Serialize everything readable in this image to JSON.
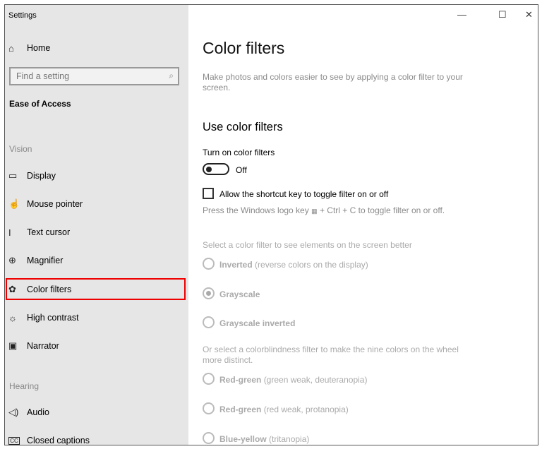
{
  "window": {
    "title": "Settings",
    "minimize": "—",
    "maximize": "☐",
    "close": "✕"
  },
  "sidebar": {
    "home": "Home",
    "search_placeholder": "Find a setting",
    "section": "Ease of Access",
    "groups": [
      {
        "label": "Vision"
      },
      {
        "label": "Hearing"
      }
    ],
    "items": [
      {
        "label": "Display",
        "icon": "display-icon"
      },
      {
        "label": "Mouse pointer",
        "icon": "mouse-pointer-icon"
      },
      {
        "label": "Text cursor",
        "icon": "text-cursor-icon"
      },
      {
        "label": "Magnifier",
        "icon": "magnifier-icon"
      },
      {
        "label": "Color filters",
        "icon": "palette-icon",
        "selected": true
      },
      {
        "label": "High contrast",
        "icon": "sun-icon"
      },
      {
        "label": "Narrator",
        "icon": "narrator-icon"
      },
      {
        "label": "Audio",
        "icon": "speaker-icon"
      },
      {
        "label": "Closed captions",
        "icon": "cc-icon"
      }
    ]
  },
  "main": {
    "title": "Color filters",
    "description": "Make photos and colors easier to see by applying a color filter to your screen.",
    "section_title": "Use color filters",
    "toggle_label": "Turn on color filters",
    "toggle_state": "Off",
    "toggle_on": false,
    "shortcut_label": "Allow the shortcut key to toggle filter on or off",
    "shortcut_checked": false,
    "shortcut_hint_pre": "Press the Windows logo key",
    "shortcut_hint_post": "+ Ctrl + C to toggle filter on or off.",
    "filter_prompt": "Select a color filter to see elements on the screen better",
    "filters": [
      {
        "name": "Inverted",
        "detail": "(reverse colors on the display)",
        "selected": false
      },
      {
        "name": "Grayscale",
        "detail": "",
        "selected": true
      },
      {
        "name": "Grayscale inverted",
        "detail": "",
        "selected": false
      }
    ],
    "colorblind_prompt": "Or select a colorblindness filter to make the nine colors on the wheel more distinct.",
    "colorblind": [
      {
        "name": "Red-green",
        "detail": "(green weak, deuteranopia)"
      },
      {
        "name": "Red-green",
        "detail": "(red weak, protanopia)"
      },
      {
        "name": "Blue-yellow",
        "detail": "(tritanopia)"
      }
    ]
  },
  "colors": {
    "sidebar_bg": "#e6e6e6",
    "highlight": "#e00000"
  }
}
